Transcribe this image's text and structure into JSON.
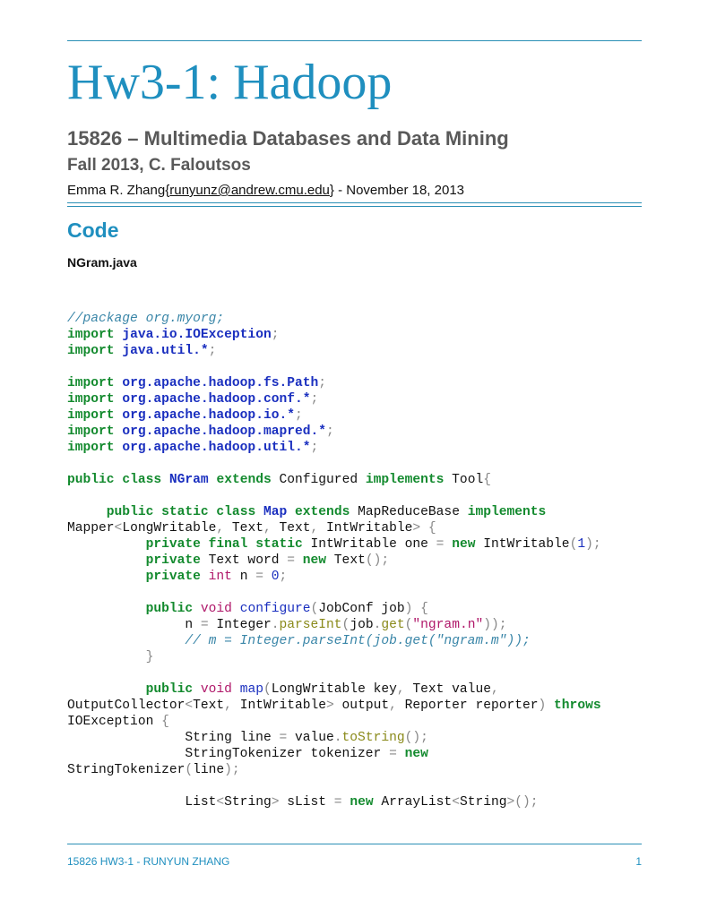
{
  "document": {
    "title": "Hw3-1: Hadoop",
    "course": "15826 – Multimedia Databases and Data Mining",
    "term": "Fall 2013, C. Faloutsos",
    "author": {
      "name": "Emma R. Zhang",
      "brace_open": "{",
      "email": "runyunz@andrew.cmu.edu",
      "brace_close": "}",
      "date_suffix": " - November 18, 2013"
    },
    "section_heading": "Code",
    "file_name": "NGram.java"
  },
  "code": {
    "comment_package": "//package org.myorg;",
    "import_kw": "import",
    "imports_java": [
      "java.io.IOException",
      "java.util.*"
    ],
    "imports_hadoop": [
      "org.apache.hadoop.fs.Path",
      "org.apache.hadoop.conf.*",
      "org.apache.hadoop.io.*",
      "org.apache.hadoop.mapred.*",
      "org.apache.hadoop.util.*"
    ],
    "semicolon": ";"
  },
  "footer": {
    "left": "15826 HW3-1 - RUNYUN ZHANG",
    "page_number": "1"
  }
}
